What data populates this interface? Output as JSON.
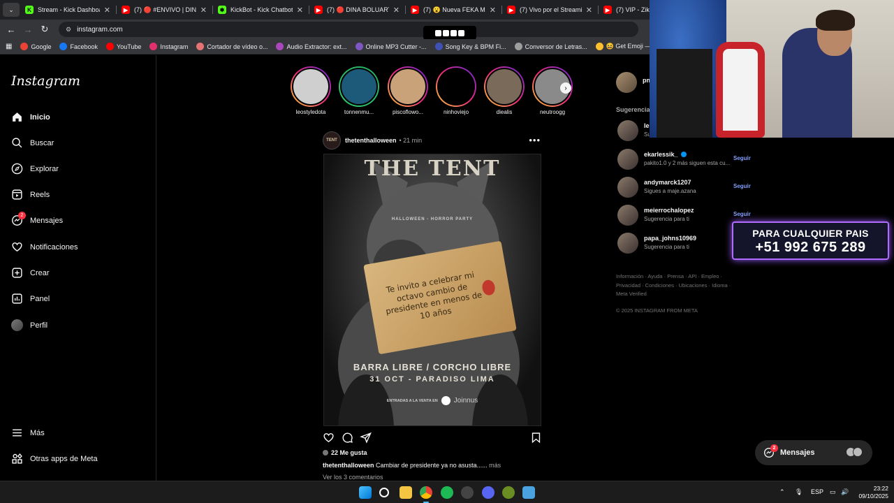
{
  "browser": {
    "tabs": [
      {
        "title": "Stream - Kick Dashboard",
        "color": "#53fc18",
        "glyph": "K"
      },
      {
        "title": "(7) 🔴 #ENVIVO | DINA B",
        "color": "#ff0000",
        "glyph": "▶"
      },
      {
        "title": "KickBot - Kick Chatbot, AI",
        "color": "#53fc18",
        "glyph": "✱"
      },
      {
        "title": "(7) 🔴 DINA BOLUARTE: C",
        "color": "#ff0000",
        "glyph": "▶"
      },
      {
        "title": "(7) 😮 Nueva FEKA MANS",
        "color": "#ff0000",
        "glyph": "▶"
      },
      {
        "title": "(7) Vivo por el Streaming",
        "color": "#ff0000",
        "glyph": "▶"
      },
      {
        "title": "(7) VIP - Zika F",
        "color": "#ff0000",
        "glyph": "▶"
      }
    ],
    "url": "instagram.com",
    "bookmarks": [
      {
        "label": "Google",
        "color": "#ea4335"
      },
      {
        "label": "Facebook",
        "color": "#1877f2"
      },
      {
        "label": "YouTube",
        "color": "#ff0000"
      },
      {
        "label": "Instagram",
        "color": "#e1306c"
      },
      {
        "label": "Cortador de vídeo o...",
        "color": "#e57373"
      },
      {
        "label": "Audio Extractor: ext...",
        "color": "#ab47bc"
      },
      {
        "label": "Online MP3 Cutter -...",
        "color": "#7e57c2"
      },
      {
        "label": "Song Key & BPM Fi...",
        "color": "#3f51b5"
      },
      {
        "label": "Conversor de Letras...",
        "color": "#9e9e9e"
      },
      {
        "label": "😆 Get Emoji — All...",
        "color": "#fbc02d"
      },
      {
        "label": "pnkz_Ofic",
        "color": "#5c6bc0"
      }
    ]
  },
  "instagram": {
    "logo": "Instagram",
    "nav": [
      {
        "label": "Inicio",
        "icon": "home-icon"
      },
      {
        "label": "Buscar",
        "icon": "search-icon"
      },
      {
        "label": "Explorar",
        "icon": "compass-icon"
      },
      {
        "label": "Reels",
        "icon": "reels-icon"
      },
      {
        "label": "Mensajes",
        "icon": "messenger-icon",
        "badge": "2"
      },
      {
        "label": "Notificaciones",
        "icon": "heart-icon"
      },
      {
        "label": "Crear",
        "icon": "plus-square-icon"
      },
      {
        "label": "Panel",
        "icon": "chart-icon"
      },
      {
        "label": "Perfil",
        "icon": "avatar"
      }
    ],
    "nav_bottom": [
      {
        "label": "Más",
        "icon": "menu-icon"
      },
      {
        "label": "Otras apps de Meta",
        "icon": "meta-apps-icon"
      }
    ],
    "stories": [
      {
        "user": "leostyledota"
      },
      {
        "user": "tonnenmu..."
      },
      {
        "user": "piscoflowo..."
      },
      {
        "user": "ninhoviejo"
      },
      {
        "user": "diealis"
      },
      {
        "user": "neutroogg"
      }
    ],
    "post": {
      "user": "thetenthalloween",
      "time": "• 21 min",
      "poster": {
        "title": "THE TENT",
        "subtitle": "HALLOWEEN - HORROR PARTY",
        "note": "Te invito a celebrar mi octavo cambio de presidente en menos de 10 años",
        "line1": "BARRA LIBRE / CORCHO LIBRE",
        "line2": "31 OCT - PARADISO LIMA",
        "tickets": "ENTRADAS A LA VENTA EN",
        "brand": "Joinnus"
      },
      "likes": "22 Me gusta",
      "caption_user": "thetenthalloween",
      "caption_text": " Cambiar de presidente ya no asusta......",
      "caption_more": " más",
      "comments": "Ver los 3 comentarios"
    },
    "sidebar": {
      "me": "pn",
      "suggestions_header": "Sugerencia",
      "suggestions": [
        {
          "user": "le",
          "sub": "Su",
          "follow": ""
        },
        {
          "user": "ekarlessik_",
          "verified": true,
          "sub": "pakito1.0 y 2 más siguen esta cu...",
          "follow": "Seguir"
        },
        {
          "user": "andymarck1207",
          "sub": "Sigues a maje.azana",
          "follow": "Seguir"
        },
        {
          "user": "meierrochalopez",
          "sub": "Sugerencia para ti",
          "follow": "Seguir"
        },
        {
          "user": "papa_johns10969",
          "sub": "Sugerencia para ti",
          "follow": ""
        }
      ],
      "footer_lines": [
        "Información · Ayuda · Prensa · API · Empleo ·",
        "Privacidad · Condiciones · Ubicaciones · Idioma ·",
        "Meta Verified"
      ],
      "copyright": "© 2025 INSTAGRAM FROM META"
    },
    "messages_pill": {
      "label": "Mensajes",
      "badge": "2"
    }
  },
  "overlay": {
    "promo_line1": "PARA CUALQUIER PAIS",
    "promo_line2": "+51 992 675 289"
  },
  "taskbar": {
    "lang": "ESP",
    "time": "23:22",
    "date": "09/10/2025"
  }
}
